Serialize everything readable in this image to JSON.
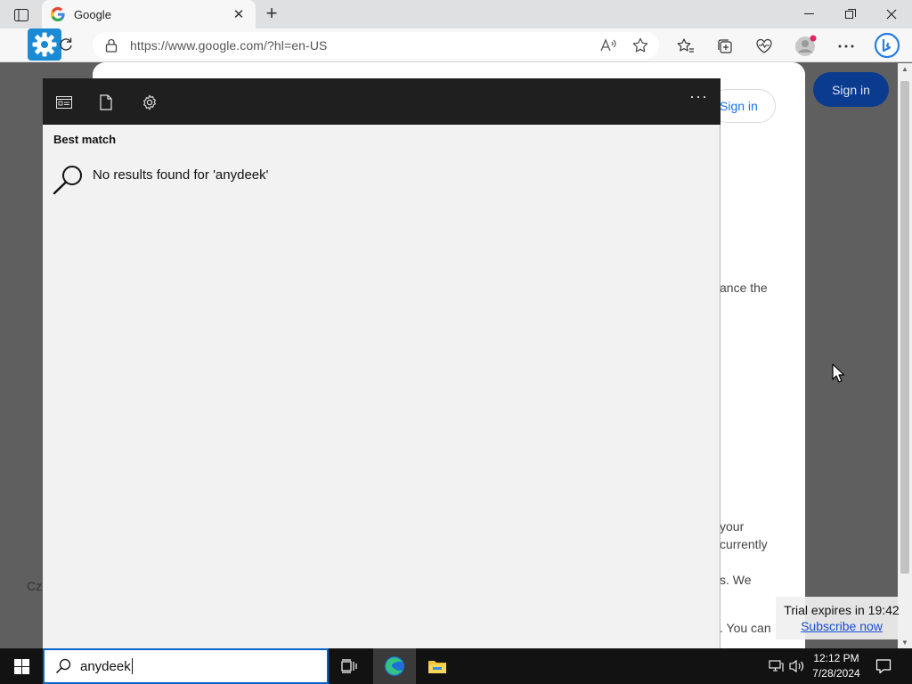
{
  "browser": {
    "tab_title": "Google",
    "tab_close": "✕",
    "new_tab": "+",
    "url": "https://www.google.com/?hl=en-US"
  },
  "page": {
    "sign_in_pill": "Sign in",
    "sign_in_button": "Sign in",
    "fragments": [
      "ance the",
      "your",
      "currently",
      "s. We",
      ". You can",
      "Cz"
    ]
  },
  "trial": {
    "text": "Trial expires in 19:42",
    "link": "Subscribe now"
  },
  "search_panel": {
    "more": "···",
    "best_match": "Best match",
    "no_results": "No results found for 'anydeek'"
  },
  "taskbar": {
    "query": "anydeek",
    "time": "12:12 PM",
    "date": "7/28/2024"
  },
  "colors": {
    "accent": "#0a63c9",
    "sign_in_bg": "#0b3b8f",
    "panel_header": "#1f1f1f",
    "taskbar": "#121212"
  }
}
